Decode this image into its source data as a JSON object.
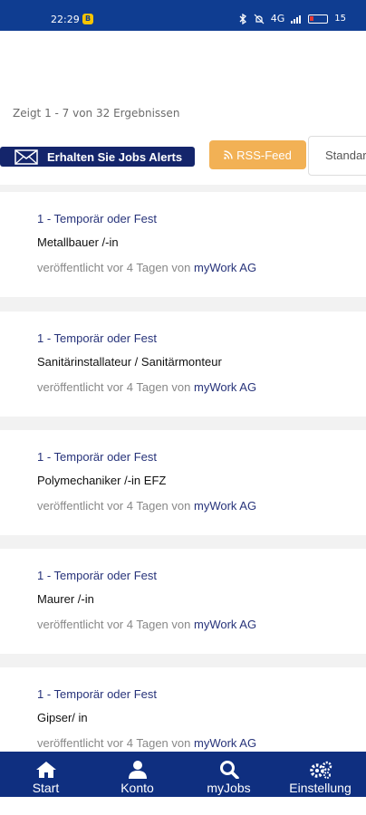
{
  "statusbar": {
    "time": "22:29",
    "notif": "B",
    "signal": "4G",
    "battery": "15"
  },
  "results": {
    "text": "Zeigt 1 - 7 von 32 Ergebnissen"
  },
  "actions": {
    "alerts_label": "Erhalten Sie Jobs Alerts",
    "rss_label": "RSS-Feed",
    "sort_value": "Standard"
  },
  "jobs": [
    {
      "type": "1 - Temporär oder Fest",
      "title": "Metallbauer /-in",
      "meta": "veröffentlicht vor 4 Tagen von",
      "company": "myWork AG"
    },
    {
      "type": "1 - Temporär oder Fest",
      "title": "Sanitärinstallateur / Sanitärmonteur",
      "meta": "veröffentlicht vor 4 Tagen von",
      "company": "myWork AG"
    },
    {
      "type": "1 - Temporär oder Fest",
      "title": "Polymechaniker /-in EFZ",
      "meta": "veröffentlicht vor 4 Tagen von",
      "company": "myWork AG"
    },
    {
      "type": "1 - Temporär oder Fest",
      "title": "Maurer /-in",
      "meta": "veröffentlicht vor 4 Tagen von",
      "company": "myWork AG"
    },
    {
      "type": "1 - Temporär oder Fest",
      "title": "Gipser/ in",
      "meta": "veröffentlicht vor 4 Tagen von",
      "company": "myWork AG"
    }
  ],
  "nav": [
    {
      "label": "Start",
      "icon": "home-icon"
    },
    {
      "label": "Konto",
      "icon": "user-icon"
    },
    {
      "label": "myJobs",
      "icon": "search-icon"
    },
    {
      "label": "Einstellung",
      "icon": "gears-icon"
    }
  ]
}
